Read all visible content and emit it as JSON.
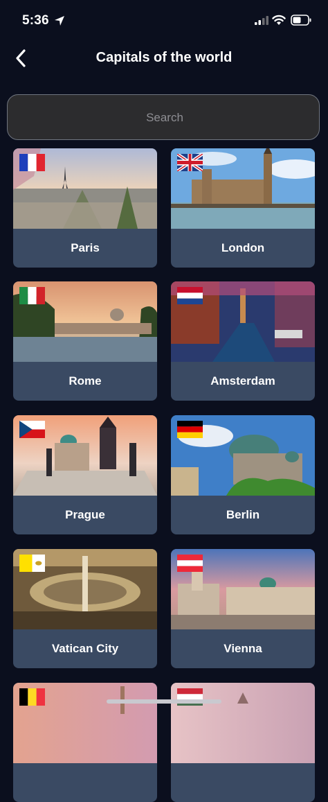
{
  "status": {
    "time": "5:36"
  },
  "nav": {
    "title": "Capitals of the world"
  },
  "search": {
    "placeholder": "Search"
  },
  "cities": [
    {
      "name": "Paris",
      "flag": "france-flag"
    },
    {
      "name": "London",
      "flag": "uk-flag"
    },
    {
      "name": "Rome",
      "flag": "italy-flag"
    },
    {
      "name": "Amsterdam",
      "flag": "netherlands-flag"
    },
    {
      "name": "Prague",
      "flag": "czech-flag"
    },
    {
      "name": "Berlin",
      "flag": "germany-flag"
    },
    {
      "name": "Vatican City",
      "flag": "vatican-flag"
    },
    {
      "name": "Vienna",
      "flag": "austria-flag"
    },
    {
      "name": "",
      "flag": "belgium-flag"
    },
    {
      "name": "",
      "flag": "hungary-flag"
    }
  ]
}
